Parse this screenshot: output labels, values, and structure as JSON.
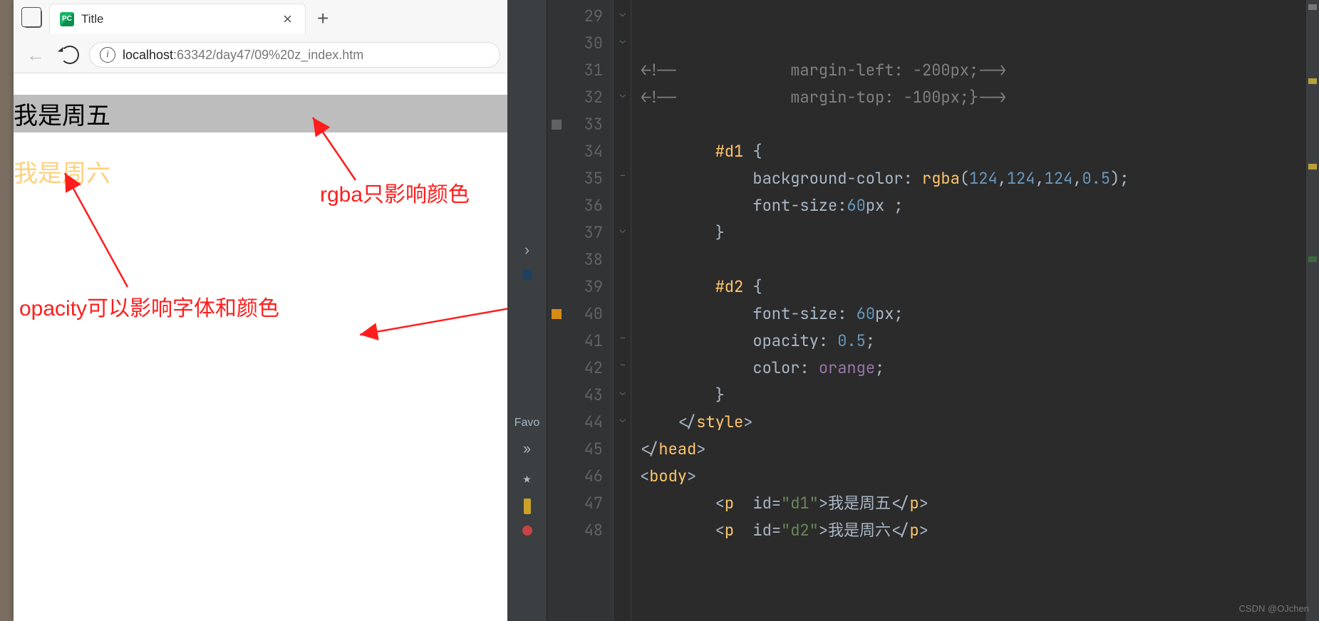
{
  "browser": {
    "tab_title": "Title",
    "url_host": "localhost",
    "url_rest": ":63342/day47/09%20z_index.htm"
  },
  "page": {
    "d1_text": "我是周五",
    "d2_text": "我是周六"
  },
  "annotations": {
    "rgba_note": "rgba只影响颜色",
    "opacity_note": "opacity可以影响字体和颜色"
  },
  "side": {
    "fav_label": "Favo",
    "chev": "»"
  },
  "code": {
    "lines": [
      {
        "n": "29",
        "cls": "tk-comment",
        "text": "<!--            margin-left: -200px;-->"
      },
      {
        "n": "30",
        "cls": "tk-comment",
        "text": "<!--            margin-top: -100px;}-->"
      },
      {
        "n": "31",
        "cls": "",
        "text": ""
      },
      {
        "n": "32",
        "html": "        <span class='tk-sel'>#d1</span> <span class='tk-brace'>{</span>"
      },
      {
        "n": "33",
        "mk": "grey",
        "html": "            <span class='tk-prop'>background-color</span>: <span class='tk-func'>rgba</span>(<span class='tk-num'>124</span>,<span class='tk-num'>124</span>,<span class='tk-num'>124</span>,<span class='tk-num'>0.5</span>);"
      },
      {
        "n": "34",
        "html": "            <span class='tk-prop'>font-size</span>:<span class='tk-num'>60</span><span class='tk-prop'>px</span> ;"
      },
      {
        "n": "35",
        "html": "        <span class='tk-brace'>}</span>"
      },
      {
        "n": "36",
        "html": ""
      },
      {
        "n": "37",
        "html": "        <span class='tk-sel'>#d2</span> <span class='tk-brace'>{</span>"
      },
      {
        "n": "38",
        "html": "            <span class='tk-prop'>font-size</span>: <span class='tk-num'>60</span><span class='tk-prop'>px</span>;"
      },
      {
        "n": "39",
        "html": "            <span class='tk-prop'>opacity</span>: <span class='tk-num'>0.5</span>;"
      },
      {
        "n": "40",
        "mk": "orange",
        "html": "            <span class='tk-prop'>color</span>: <span class='tk-kwcolor'>orange</span>;"
      },
      {
        "n": "41",
        "html": "        <span class='tk-brace'>}</span>"
      },
      {
        "n": "42",
        "html": "    &lt;/<span class='tk-tag'>style</span>&gt;"
      },
      {
        "n": "43",
        "html": "&lt;/<span class='tk-tag'>head</span>&gt;"
      },
      {
        "n": "44",
        "html": "&lt;<span class='tk-tag'>body</span>&gt;"
      },
      {
        "n": "45",
        "html": "        &lt;<span class='tk-tag'>p</span>  <span class='tk-attr'>id</span>=<span class='tk-str'>\"d1\"</span>&gt;<span class='tk-text'>我是周五</span>&lt;/<span class='tk-tag'>p</span>&gt;"
      },
      {
        "n": "46",
        "html": "        &lt;<span class='tk-tag'>p</span>  <span class='tk-attr'>id</span>=<span class='tk-str'>\"d2\"</span>&gt;<span class='tk-text'>我是周六</span>&lt;/<span class='tk-tag'>p</span>&gt;"
      },
      {
        "n": "47",
        "html": ""
      },
      {
        "n": "48",
        "html": ""
      }
    ]
  },
  "watermark": "CSDN @OJchen"
}
